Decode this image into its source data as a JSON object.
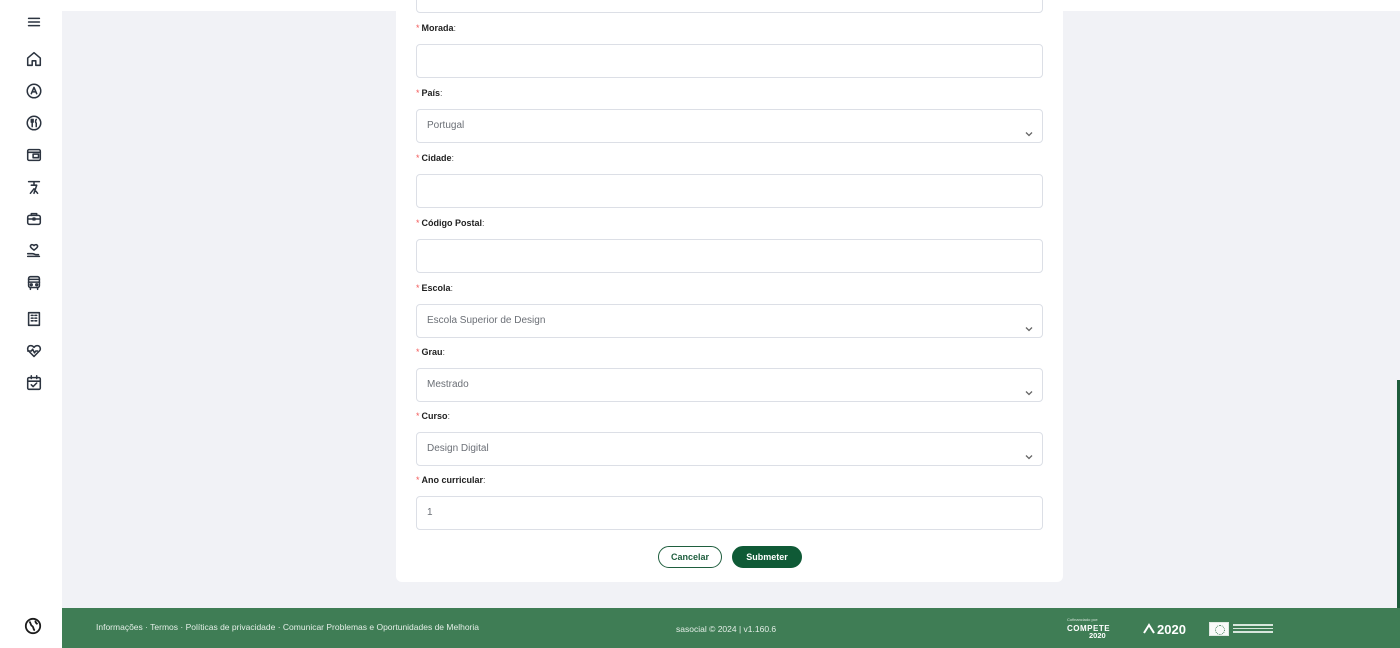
{
  "form": {
    "fields": [
      {
        "label": "Morada",
        "required": true,
        "type": "text",
        "value": ""
      },
      {
        "label": "País",
        "required": true,
        "type": "select",
        "value": "Portugal"
      },
      {
        "label": "Cidade",
        "required": true,
        "type": "text",
        "value": ""
      },
      {
        "label": "Código Postal",
        "required": true,
        "type": "text",
        "value": ""
      },
      {
        "label": "Escola",
        "required": true,
        "type": "select",
        "value": "Escola Superior de Design"
      },
      {
        "label": "Grau",
        "required": true,
        "type": "select",
        "value": "Mestrado"
      },
      {
        "label": "Curso",
        "required": true,
        "type": "select",
        "value": "Design Digital"
      },
      {
        "label": "Ano curricular",
        "required": true,
        "type": "text",
        "value": "1"
      }
    ],
    "required_marker": "*",
    "colon": ":",
    "cancel_label": "Cancelar",
    "submit_label": "Submeter"
  },
  "sidebar": {
    "icons": [
      "menu-icon",
      "home-icon",
      "location-pin-icon",
      "restaurant-icon",
      "wallet-icon",
      "bike-icon",
      "briefcase-icon",
      "care-hand-icon",
      "bus-icon",
      "building-icon",
      "health-icon",
      "calendar-check-icon",
      "globe-icon"
    ]
  },
  "footer": {
    "links_text": "Informações · Termos · Políticas de privacidade · Comunicar Problemas e Oportunidades de Melhoria",
    "copyright": "sasocial © 2024 | v1.160.6",
    "logo_compete_caption": "Cofinanciado por:",
    "logo_compete": "COMPETE",
    "logo_compete_year": "2020",
    "logo_portugal": "2020"
  },
  "colors": {
    "primary": "#0f5a36",
    "footer_bg": "#3f7d55",
    "required": "#f35a5a",
    "page_bg": "#f1f2f6"
  }
}
